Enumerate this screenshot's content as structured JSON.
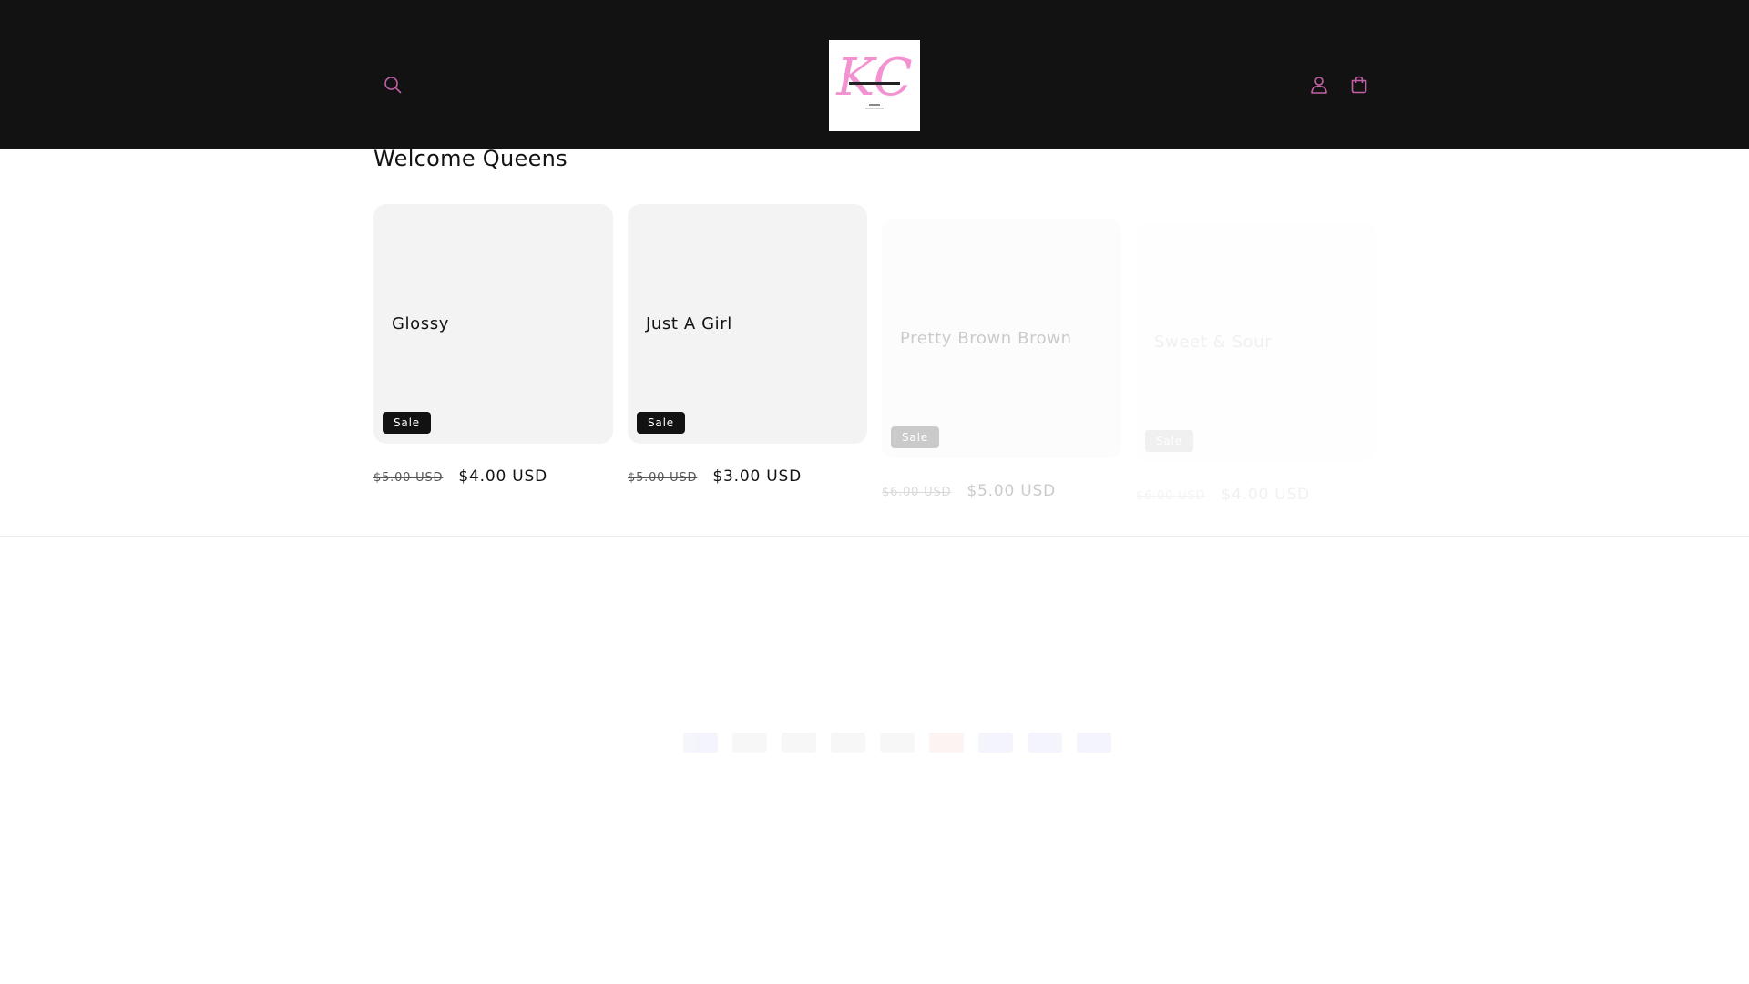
{
  "header": {
    "search_icon": "search-icon",
    "account_icon": "account-icon",
    "cart_icon": "cart-icon",
    "logo_text": "KC",
    "logo_subtext": "KRISTANIAS COSMETICS",
    "icon_color": "#c45fa8",
    "background": "#121212"
  },
  "collection": {
    "title": "Welcome Queens",
    "products": [
      {
        "title": "Glossy",
        "badge": "Sale",
        "compare_price": "$5.00 USD",
        "price": "$4.00 USD"
      },
      {
        "title": "Just A Girl",
        "badge": "Sale",
        "compare_price": "$5.00 USD",
        "price": "$3.00 USD"
      },
      {
        "title": "Pretty Brown Brown",
        "badge": "Sale",
        "compare_price": "$6.00 USD",
        "price": "$5.00 USD"
      },
      {
        "title": "Sweet & Sour",
        "badge": "Sale",
        "compare_price": "$6.00 USD",
        "price": "$4.00 USD"
      }
    ]
  },
  "footer": {
    "payment_icons": [
      "american-express-icon",
      "apple-pay-icon",
      "diners-club-icon",
      "discover-icon",
      "google-pay-icon",
      "mastercard-icon",
      "paypal-icon",
      "shop-pay-icon",
      "visa-icon"
    ]
  }
}
